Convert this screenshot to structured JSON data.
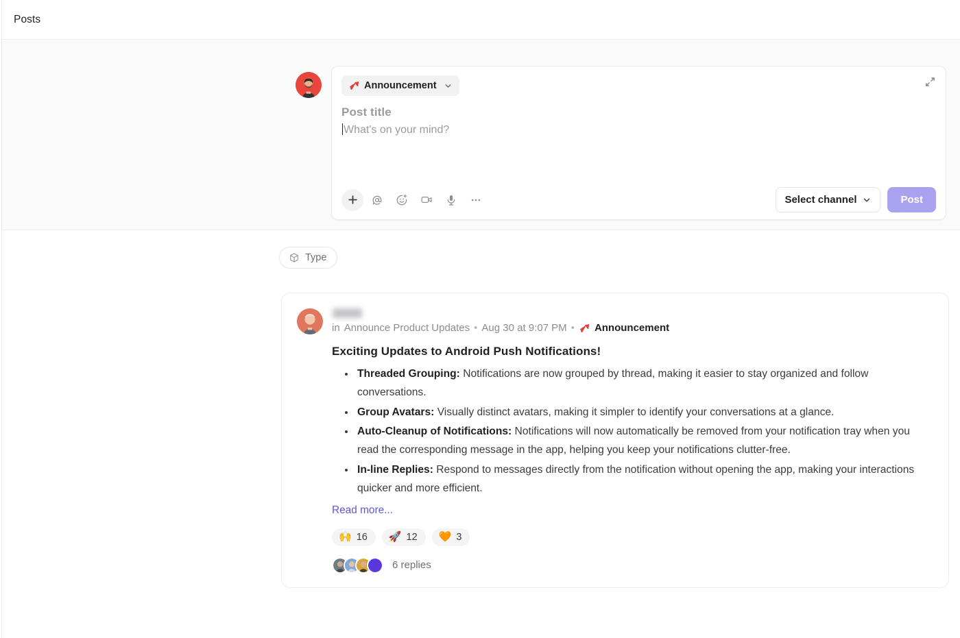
{
  "header": {
    "title": "Posts"
  },
  "composer": {
    "type_chip": {
      "label": "Announcement",
      "icon": "megaphone-icon",
      "chevron": "chevron-down-icon"
    },
    "title_placeholder": "Post title",
    "body_placeholder": "What's on your mind?",
    "expand_icon": "expand-icon",
    "tools": [
      {
        "name": "add-icon",
        "glyph": "plus"
      },
      {
        "name": "mention-icon",
        "glyph": "mention"
      },
      {
        "name": "emoji-icon",
        "glyph": "emoji"
      },
      {
        "name": "video-icon",
        "glyph": "video"
      },
      {
        "name": "microphone-icon",
        "glyph": "mic"
      },
      {
        "name": "more-options-icon",
        "glyph": "dots"
      }
    ],
    "channel_select": {
      "label": "Select channel",
      "chevron": "chevron-down-icon"
    },
    "post_button": {
      "label": "Post",
      "color": "#a9a2ef",
      "enabled": false
    }
  },
  "feed": {
    "filters": [
      {
        "label": "Type",
        "icon": "cube-icon"
      }
    ],
    "post": {
      "author_name": "",
      "author_redacted": true,
      "meta": {
        "in_label": "in",
        "channel": "Announce Product Updates",
        "separator": "•",
        "timestamp": "Aug 30 at 9:07 PM",
        "tag": "Announcement",
        "tag_icon": "megaphone-icon",
        "tag_color": "#e0403a"
      },
      "title": "Exciting Updates to Android Push Notifications!",
      "bullets": [
        {
          "lead": "Threaded Grouping:",
          "text": " Notifications are now grouped by thread, making it easier to stay organized and follow conversations."
        },
        {
          "lead": "Group Avatars:",
          "text": " Visually distinct avatars, making it simpler to identify your conversations at a glance."
        },
        {
          "lead": "Auto-Cleanup of Notifications:",
          "text": " Notifications will now automatically be removed from your notification tray when you read the corresponding message in the app, helping you keep your notifications clutter-free."
        },
        {
          "lead": "In-line Replies:",
          "text": " Respond to messages directly from the notification without opening the app, making your interactions quicker and more efficient."
        }
      ],
      "read_more": "Read more...",
      "read_more_color": "#5d57d6",
      "reactions": [
        {
          "emoji": "🙌",
          "count": "16"
        },
        {
          "emoji": "🚀",
          "count": "12"
        },
        {
          "emoji": "🧡",
          "count": "3"
        }
      ],
      "replies_label": "6 replies",
      "reply_avatars": [
        "#7d7a72",
        "#7fa9d8",
        "#d9a63a",
        "#5b37e0"
      ]
    }
  }
}
